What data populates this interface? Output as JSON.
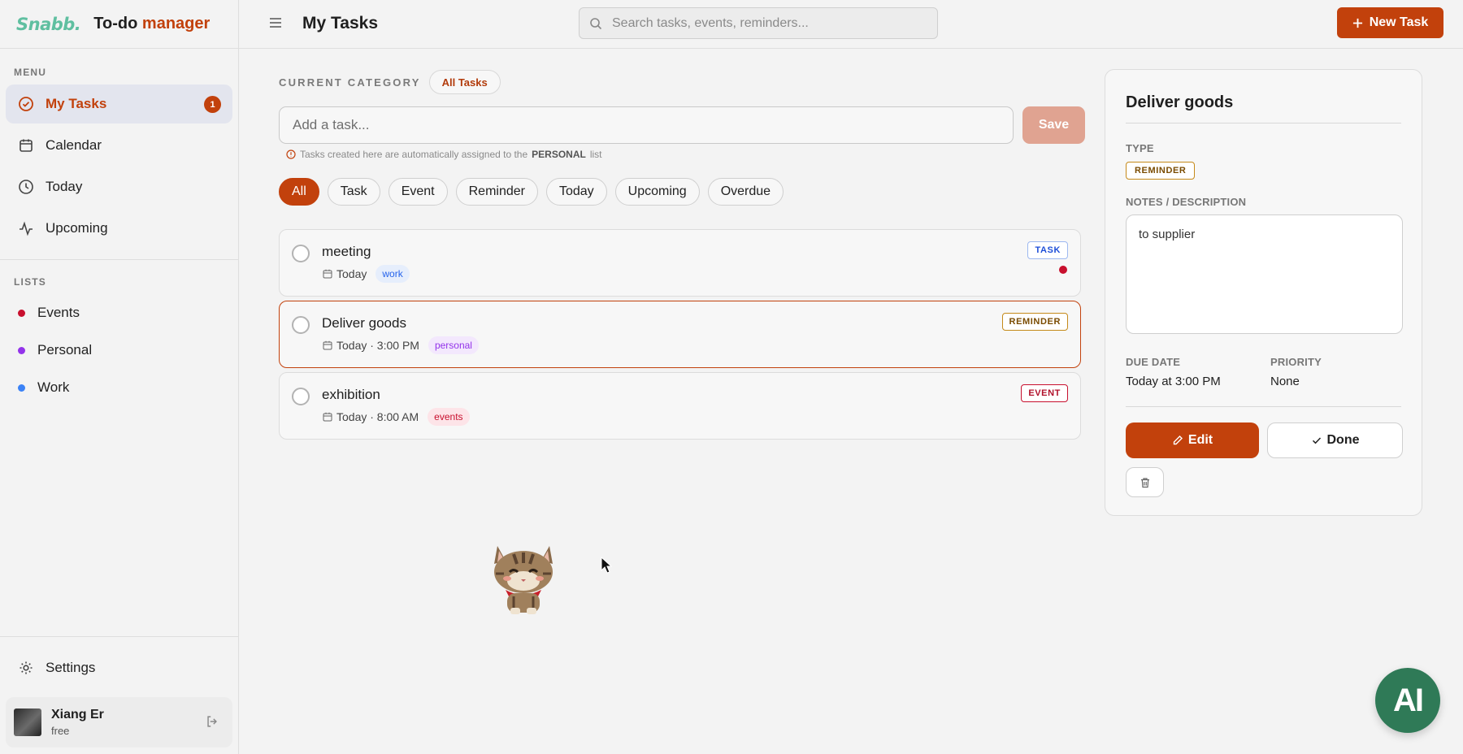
{
  "brand": {
    "logo": "Snabb.",
    "app_prefix": "To-do ",
    "app_accent": "manager"
  },
  "sidebar": {
    "menu_label": "MENU",
    "menu_items": [
      {
        "label": "My Tasks",
        "icon": "check-circle-icon",
        "active": true,
        "badge": "1"
      },
      {
        "label": "Calendar",
        "icon": "calendar-icon"
      },
      {
        "label": "Today",
        "icon": "clock-icon"
      },
      {
        "label": "Upcoming",
        "icon": "activity-icon"
      }
    ],
    "lists_label": "LISTS",
    "lists": [
      {
        "label": "Events",
        "color": "#c8102e"
      },
      {
        "label": "Personal",
        "color": "#9333ea"
      },
      {
        "label": "Work",
        "color": "#3b82f6"
      }
    ],
    "settings_label": "Settings",
    "user": {
      "name": "Xiang Er",
      "plan": "free"
    }
  },
  "topbar": {
    "title": "My Tasks",
    "search_placeholder": "Search tasks, events, reminders...",
    "new_task_label": "New Task"
  },
  "main": {
    "category_label": "CURRENT CATEGORY",
    "category_value": "All Tasks",
    "add_placeholder": "Add a task...",
    "save_label": "Save",
    "hint_prefix": "Tasks created here are automatically assigned to the",
    "hint_list": "PERSONAL",
    "hint_suffix": "list",
    "filters": [
      "All",
      "Task",
      "Event",
      "Reminder",
      "Today",
      "Upcoming",
      "Overdue"
    ],
    "active_filter": "All",
    "tasks": [
      {
        "title": "meeting",
        "when": "Today",
        "tag": "work",
        "type": "TASK",
        "has_dot": true
      },
      {
        "title": "Deliver goods",
        "when": "Today · 3:00 PM",
        "tag": "personal",
        "type": "REMINDER",
        "selected": true
      },
      {
        "title": "exhibition",
        "when": "Today · 8:00 AM",
        "tag": "events",
        "type": "EVENT"
      }
    ]
  },
  "details": {
    "title": "Deliver goods",
    "type_label": "TYPE",
    "type_value": "REMINDER",
    "notes_label": "NOTES / DESCRIPTION",
    "notes_value": "to supplier",
    "due_label": "DUE DATE",
    "due_value": "Today at 3:00 PM",
    "priority_label": "PRIORITY",
    "priority_value": "None",
    "edit_label": "Edit",
    "done_label": "Done"
  },
  "fab": {
    "label": "AI"
  },
  "colors": {
    "accent": "#c2410c",
    "tag_work_bg": "#e6eefc",
    "tag_work_fg": "#2563eb",
    "tag_personal_bg": "#f3e8fd",
    "tag_personal_fg": "#9333ea",
    "tag_events_bg": "#fde4e8",
    "tag_events_fg": "#c8102e",
    "type_task": "#1d4ed8",
    "type_reminder": "#c58a1a",
    "type_event": "#c8102e"
  }
}
